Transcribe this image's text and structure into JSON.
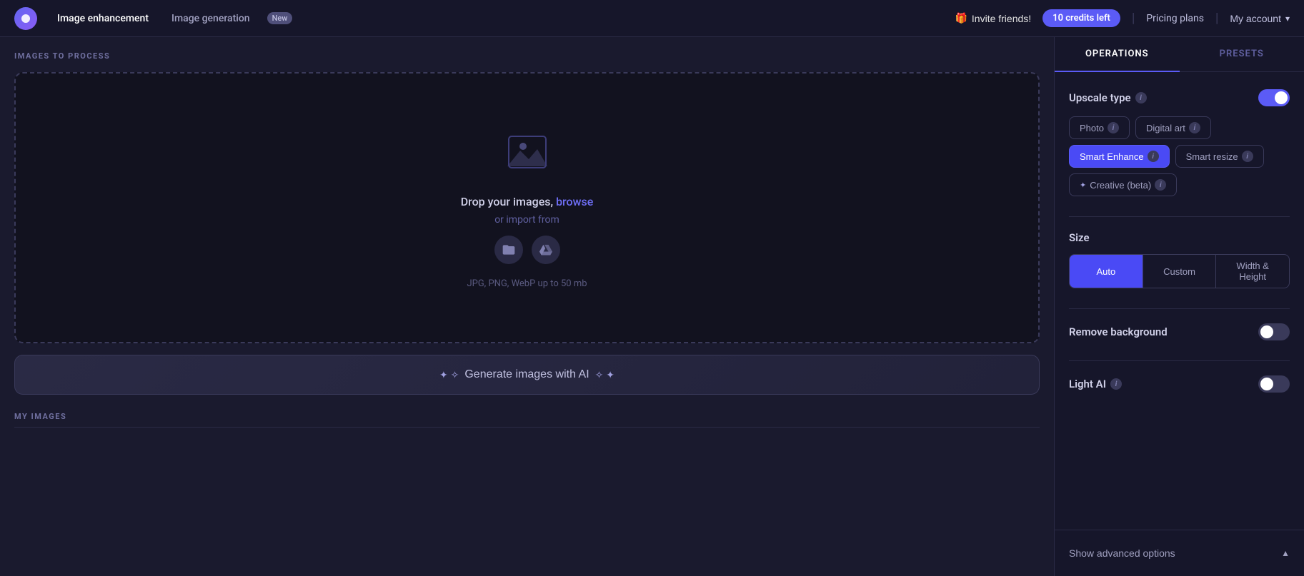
{
  "header": {
    "logo_label": "Logo",
    "nav": [
      {
        "id": "image-enhancement",
        "label": "Image enhancement",
        "active": true
      },
      {
        "id": "image-generation",
        "label": "Image generation",
        "active": false
      }
    ],
    "new_badge": "New",
    "invite_emoji": "🎁",
    "invite_label": "Invite friends!",
    "credits_label": "10 credits left",
    "divider": "|",
    "pricing_label": "Pricing plans",
    "account_label": "My account",
    "chevron": "▾"
  },
  "left_panel": {
    "images_section_title": "IMAGES TO PROCESS",
    "drop_zone": {
      "drop_text": "Drop your images,",
      "browse_link": "browse",
      "or_import": "or import from",
      "file_types": "JPG, PNG, WebP up to 50 mb",
      "folder_icon": "📁",
      "drive_icon": "☁"
    },
    "generate_btn": {
      "sparkle_left": "✦ ✧",
      "label": "Generate images with AI",
      "sparkle_right": "✧ ✦"
    },
    "my_images_title": "MY IMAGES"
  },
  "right_panel": {
    "tabs": [
      {
        "id": "operations",
        "label": "OPERATIONS",
        "active": true
      },
      {
        "id": "presets",
        "label": "PRESETS",
        "active": false
      }
    ],
    "upscale_type": {
      "label": "Upscale type",
      "enabled": true,
      "types": [
        {
          "id": "photo",
          "label": "Photo",
          "active": false
        },
        {
          "id": "digital-art",
          "label": "Digital art",
          "active": false
        },
        {
          "id": "smart-enhance",
          "label": "Smart Enhance",
          "active": true,
          "has_sparkle": false
        },
        {
          "id": "smart-resize",
          "label": "Smart resize",
          "active": false
        },
        {
          "id": "creative-beta",
          "label": "Creative (beta)",
          "active": false,
          "has_sparkle": true
        }
      ]
    },
    "size": {
      "label": "Size",
      "options": [
        {
          "id": "auto",
          "label": "Auto",
          "active": true
        },
        {
          "id": "custom",
          "label": "Custom",
          "active": false
        },
        {
          "id": "width-height",
          "label": "Width & Height",
          "active": false
        }
      ]
    },
    "remove_background": {
      "label": "Remove background",
      "enabled": false
    },
    "light_ai": {
      "label": "Light AI",
      "enabled": false
    },
    "advanced_options": {
      "label": "Show advanced options",
      "chevron": "▲"
    }
  }
}
